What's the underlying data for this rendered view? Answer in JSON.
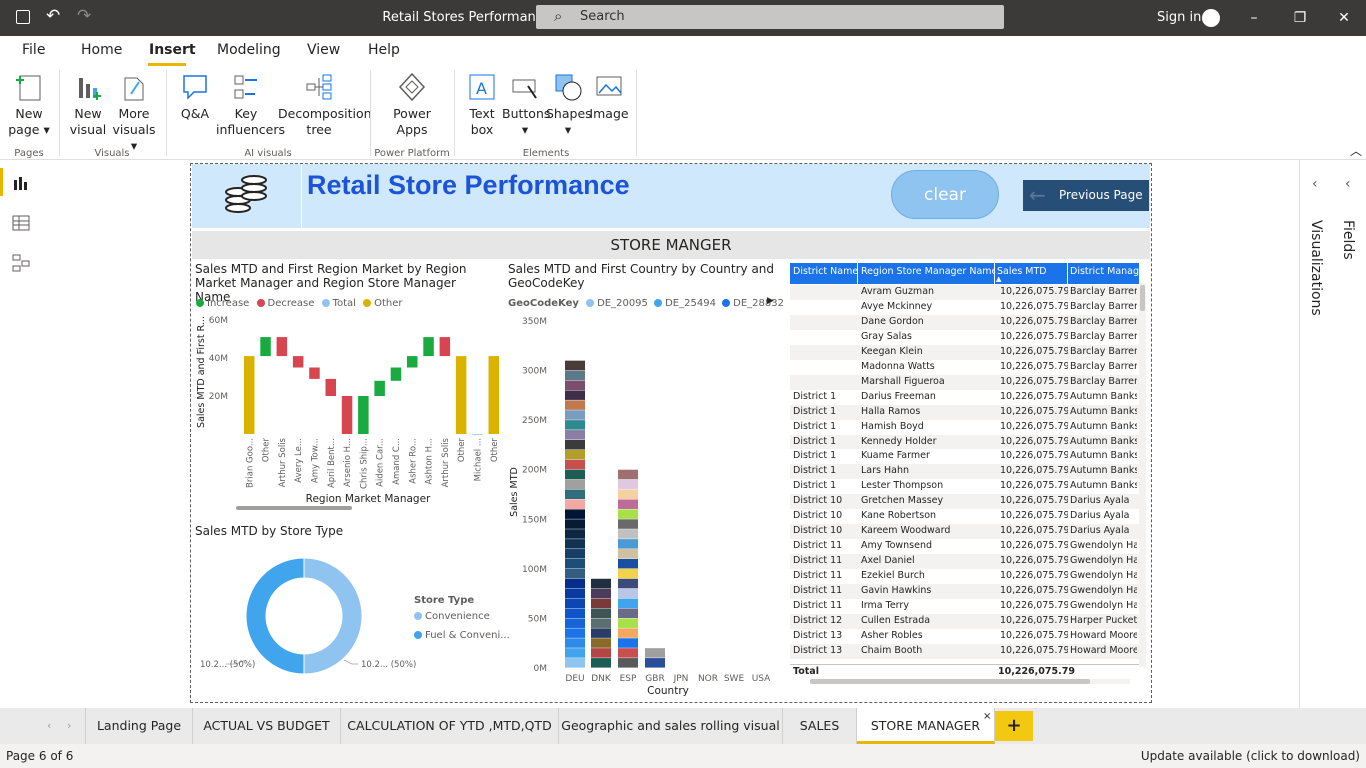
{
  "titlebar": {
    "title": "Retail Stores Performance finall - Power BI Desktop",
    "search_label": "Search",
    "signin": "Sign in"
  },
  "menu": [
    "File",
    "Home",
    "Insert",
    "Modeling",
    "View",
    "Help"
  ],
  "ribbon": {
    "new_page": [
      "New",
      "page"
    ],
    "new_visual": [
      "New",
      "visual"
    ],
    "more_visuals": [
      "More",
      "visuals"
    ],
    "qna": "Q&A",
    "key_influencers": [
      "Key",
      "influencers"
    ],
    "decomposition_tree": [
      "Decomposition",
      "tree"
    ],
    "power_apps": [
      "Power",
      "Apps"
    ],
    "text_box": [
      "Text",
      "box"
    ],
    "buttons": "Buttons",
    "shapes": "Shapes",
    "image": "Image",
    "groups": {
      "pages": "Pages",
      "visuals": "Visuals",
      "ai_visuals": "AI visuals",
      "power_platform": "Power Platform",
      "elements": "Elements"
    }
  },
  "right_pane": {
    "visualizations": "Visualizations",
    "fields": "Fields"
  },
  "report": {
    "title": "Retail Store Performance",
    "clear": "clear",
    "previous_page": "Previous Page",
    "section": "STORE MANGER"
  },
  "waterfall": {
    "title": "Sales MTD and First Region Market by Region Market Manager and Region Store Manager Name",
    "legend": [
      {
        "label": "Increase",
        "color": "#1aab40"
      },
      {
        "label": "Decrease",
        "color": "#d64550"
      },
      {
        "label": "Total",
        "color": "#8fc3f0"
      },
      {
        "label": "Other",
        "color": "#d9b300"
      }
    ],
    "ylabel": "Sales MTD and First R...",
    "xlabel": "Region Market Manager",
    "yticks": [
      "60M",
      "40M",
      "20M"
    ]
  },
  "stacked": {
    "title": "Sales MTD and First Country by Country and GeoCodeKey",
    "legend_title": "GeoCodeKey",
    "legend": [
      {
        "label": "DE_20095",
        "color": "#8fc3f0"
      },
      {
        "label": "DE_25494",
        "color": "#41a5ee"
      },
      {
        "label": "DE_28832",
        "color": "#1a73e8"
      }
    ],
    "ylabel": "Sales MTD",
    "xlabel": "Country"
  },
  "donut": {
    "title": "Sales MTD by Store Type",
    "legend_title": "Store Type",
    "legend": [
      {
        "label": "Convenience",
        "color": "#8fc3f0"
      },
      {
        "label": "Fuel & Conveni...",
        "color": "#41a5ee"
      }
    ],
    "label_left": "10.2... (50%)",
    "label_right": "10.2... (50%)"
  },
  "table": {
    "columns": [
      "District Name",
      "Region Store Manager Name",
      "Sales MTD",
      "District Manager"
    ],
    "rows": [
      [
        "",
        "Avram Guzman",
        "10,226,075.79",
        "Barclay Barrera"
      ],
      [
        "",
        "Avye Mckinney",
        "10,226,075.79",
        "Barclay Barrera"
      ],
      [
        "",
        "Dane Gordon",
        "10,226,075.79",
        "Barclay Barrera"
      ],
      [
        "",
        "Gray Salas",
        "10,226,075.79",
        "Barclay Barrera"
      ],
      [
        "",
        "Keegan Klein",
        "10,226,075.79",
        "Barclay Barrera"
      ],
      [
        "",
        "Madonna Watts",
        "10,226,075.79",
        "Barclay Barrera"
      ],
      [
        "",
        "Marshall Figueroa",
        "10,226,075.79",
        "Barclay Barrera"
      ],
      [
        "District 1",
        "Darius Freeman",
        "10,226,075.79",
        "Autumn Banks"
      ],
      [
        "District 1",
        "Halla Ramos",
        "10,226,075.79",
        "Autumn Banks"
      ],
      [
        "District 1",
        "Hamish Boyd",
        "10,226,075.79",
        "Autumn Banks"
      ],
      [
        "District 1",
        "Kennedy Holder",
        "10,226,075.79",
        "Autumn Banks"
      ],
      [
        "District 1",
        "Kuame Farmer",
        "10,226,075.79",
        "Autumn Banks"
      ],
      [
        "District 1",
        "Lars Hahn",
        "10,226,075.79",
        "Autumn Banks"
      ],
      [
        "District 1",
        "Lester Thompson",
        "10,226,075.79",
        "Autumn Banks"
      ],
      [
        "District 10",
        "Gretchen Massey",
        "10,226,075.79",
        "Darius Ayala"
      ],
      [
        "District 10",
        "Kane Robertson",
        "10,226,075.79",
        "Darius Ayala"
      ],
      [
        "District 10",
        "Kareem Woodward",
        "10,226,075.79",
        "Darius Ayala"
      ],
      [
        "District 11",
        "Amy Townsend",
        "10,226,075.79",
        "Gwendolyn Har"
      ],
      [
        "District 11",
        "Axel Daniel",
        "10,226,075.79",
        "Gwendolyn Har"
      ],
      [
        "District 11",
        "Ezekiel Burch",
        "10,226,075.79",
        "Gwendolyn Har"
      ],
      [
        "District 11",
        "Gavin Hawkins",
        "10,226,075.79",
        "Gwendolyn Har"
      ],
      [
        "District 11",
        "Irma Terry",
        "10,226,075.79",
        "Gwendolyn Har"
      ],
      [
        "District 12",
        "Cullen Estrada",
        "10,226,075.79",
        "Harper Puckett"
      ],
      [
        "District 13",
        "Asher Robles",
        "10,226,075.79",
        "Howard Moore"
      ],
      [
        "District 13",
        "Chaim Booth",
        "10,226,075.79",
        "Howard Moore"
      ]
    ],
    "total_label": "Total",
    "total_value": "10,226,075.79"
  },
  "tabs": [
    "Landing Page",
    "ACTUAL VS BUDGET",
    "CALCULATION OF YTD ,MTD,QTD",
    "Geographic and sales rolling visual",
    "SALES",
    "STORE MANAGER"
  ],
  "status": {
    "page": "Page 6 of 6",
    "update": "Update available (click to download)"
  },
  "chart_data": [
    {
      "type": "bar",
      "subtype": "waterfall",
      "title": "Sales MTD and First Region Market by Region Market Manager and Region Store Manager Name",
      "categories": [
        "Brian Goo...",
        "Other",
        "Arthur Solis",
        "Avery Le...",
        "Amy Tow...",
        "April Bent...",
        "Arsenio H...",
        "Chris Ship...",
        "Aiden Car...",
        "Amand C...",
        "Asher Ro...",
        "Ashton H...",
        "Arthur Solis",
        "Other",
        "Michael ...",
        "Other"
      ],
      "bars": [
        {
          "start": 0,
          "end": 41,
          "kind": "Other"
        },
        {
          "start": 41,
          "end": 51,
          "kind": "Increase"
        },
        {
          "start": 51,
          "end": 41,
          "kind": "Decrease"
        },
        {
          "start": 41,
          "end": 35,
          "kind": "Decrease"
        },
        {
          "start": 35,
          "end": 29,
          "kind": "Decrease"
        },
        {
          "start": 29,
          "end": 20,
          "kind": "Decrease"
        },
        {
          "start": 20,
          "end": 0,
          "kind": "Decrease"
        },
        {
          "start": 0,
          "end": 20,
          "kind": "Increase"
        },
        {
          "start": 20,
          "end": 28,
          "kind": "Increase"
        },
        {
          "start": 28,
          "end": 35,
          "kind": "Increase"
        },
        {
          "start": 35,
          "end": 41,
          "kind": "Increase"
        },
        {
          "start": 41,
          "end": 51,
          "kind": "Increase"
        },
        {
          "start": 51,
          "end": 41,
          "kind": "Decrease"
        },
        {
          "start": 0,
          "end": 41,
          "kind": "Other"
        },
        {
          "start": 0,
          "end": 0,
          "kind": "Total"
        },
        {
          "start": 0,
          "end": 41,
          "kind": "Other"
        }
      ],
      "ylim": [
        0,
        60
      ],
      "ylabel": "Sales MTD and First R...",
      "xlabel": "Region Market Manager"
    },
    {
      "type": "bar",
      "subtype": "stacked",
      "title": "Sales MTD and First Country by Country and GeoCodeKey",
      "categories": [
        "DEU",
        "DNK",
        "ESP",
        "GBR",
        "JPN",
        "NOR",
        "SWE",
        "USA"
      ],
      "stacks": [
        {
          "cat": "DEU",
          "segments": [
            10,
            10,
            10,
            10,
            10,
            10,
            10,
            10,
            10,
            10,
            10,
            10,
            10,
            10,
            10,
            10,
            10,
            10,
            10,
            10,
            10,
            10,
            10,
            10,
            10,
            10,
            10,
            10,
            10,
            10,
            10
          ],
          "colors": [
            "#8fc3f0",
            "#41a5ee",
            "#2d8ae8",
            "#1a73e8",
            "#1565d8",
            "#0f55c7",
            "#0b46b5",
            "#083aa0",
            "#052d8a",
            "#325c80",
            "#1d4e79",
            "#173f66",
            "#123254",
            "#0d2743",
            "#061c36",
            "#031534",
            "#f4a7a3",
            "#2f6e7a",
            "#a0a0a0",
            "#1c5d54",
            "#c64f4f",
            "#b0a02b",
            "#3b3b3b",
            "#8b7ea6",
            "#2f8a8f",
            "#7a9cc0",
            "#c07850",
            "#3d2f4a",
            "#7a4f6e",
            "#5a7a8a",
            "#4a3a3a"
          ]
        },
        {
          "cat": "DNK",
          "segments": [
            10,
            10,
            10,
            10,
            10,
            10,
            10,
            10,
            10
          ],
          "colors": [
            "#1c5d54",
            "#b34545",
            "#8a6a2a",
            "#2a3d66",
            "#5a6f6f",
            "#3d5555",
            "#7a3a3a",
            "#4b3b5c",
            "#1f2f3f"
          ]
        },
        {
          "cat": "ESP",
          "segments": [
            10,
            10,
            10,
            10,
            10,
            10,
            10,
            10,
            10,
            10,
            10,
            10,
            10,
            10,
            10,
            10,
            10,
            10,
            10,
            10
          ],
          "colors": [
            "#5a5a5a",
            "#c64f4f",
            "#1a73e8",
            "#f2a95f",
            "#a8e04a",
            "#6a6a8a",
            "#41a5ee",
            "#b6c8e6",
            "#3d4a7a",
            "#f4d24a",
            "#1a4fa3",
            "#d0c0a0",
            "#4a9ad6",
            "#c0c0c0",
            "#6a6a6a",
            "#a8e04a",
            "#c06a9a",
            "#f4d2a0",
            "#e0c8e0",
            "#a07070"
          ]
        },
        {
          "cat": "GBR",
          "segments": [
            10,
            10
          ],
          "colors": [
            "#2a4f9a",
            "#a0a0a0"
          ]
        }
      ],
      "ylim": [
        0,
        350
      ],
      "yticks": [
        "350M",
        "300M",
        "250M",
        "200M",
        "150M",
        "100M",
        "50M",
        "0M"
      ],
      "ylabel": "Sales MTD",
      "xlabel": "Country"
    },
    {
      "type": "pie",
      "subtype": "donut",
      "title": "Sales MTD by Store Type",
      "slices": [
        {
          "label": "Convenience",
          "percent": 50
        },
        {
          "label": "Fuel & Conveni...",
          "percent": 50
        }
      ]
    }
  ]
}
